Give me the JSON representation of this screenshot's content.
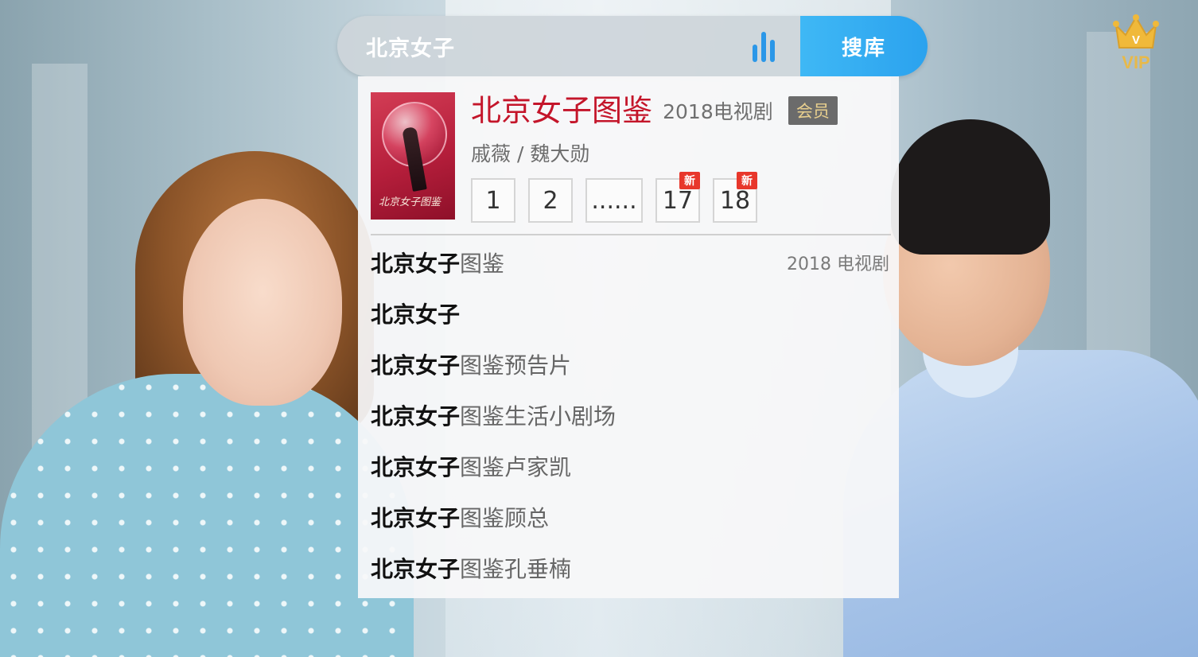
{
  "search": {
    "query": "北京女子",
    "button_label": "搜库"
  },
  "vip": {
    "label": "VIP"
  },
  "top_result": {
    "title": "北京女子图鉴",
    "year_type": "2018电视剧",
    "badge": "会员",
    "cast": "戚薇 / 魏大勋",
    "poster_title": "北京女子图鉴",
    "episodes": [
      {
        "label": "1",
        "is_new": false
      },
      {
        "label": "2",
        "is_new": false
      },
      {
        "label": "......",
        "is_new": false
      },
      {
        "label": "17",
        "is_new": true
      },
      {
        "label": "18",
        "is_new": true
      }
    ],
    "new_badge": "新"
  },
  "suggestions": [
    {
      "highlight": "北京女子",
      "rest": "图鉴",
      "meta": "2018 电视剧"
    },
    {
      "highlight": "北京女子",
      "rest": "",
      "meta": ""
    },
    {
      "highlight": "北京女子",
      "rest": "图鉴预告片",
      "meta": ""
    },
    {
      "highlight": "北京女子",
      "rest": "图鉴生活小剧场",
      "meta": ""
    },
    {
      "highlight": "北京女子",
      "rest": "图鉴卢家凯",
      "meta": ""
    },
    {
      "highlight": "北京女子",
      "rest": "图鉴顾总",
      "meta": ""
    },
    {
      "highlight": "北京女子",
      "rest": "图鉴孔垂楠",
      "meta": ""
    }
  ],
  "colors": {
    "accent": "#2ba2ee",
    "title_red": "#c4152a",
    "new_badge": "#e8372b",
    "vip_gold": "#e7b94a"
  }
}
